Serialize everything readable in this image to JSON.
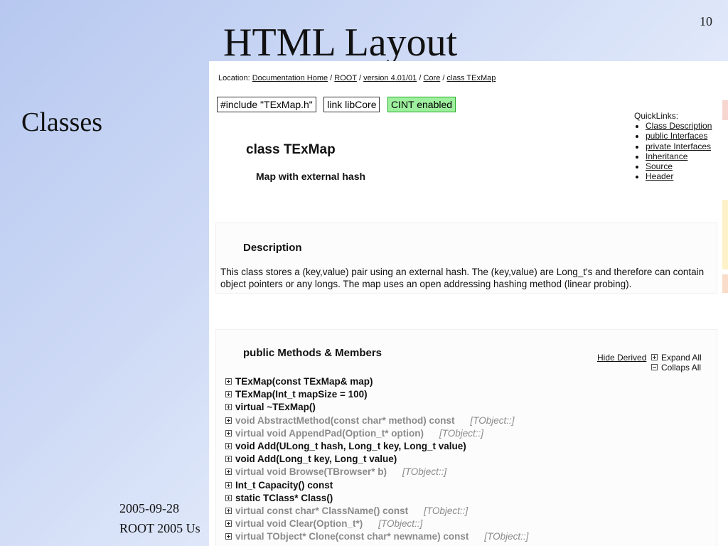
{
  "slide": {
    "number": "10",
    "title": "HTML Layout",
    "side_label": "Classes",
    "footer_date": "2005-09-28",
    "footer_conf": "ROOT 2005 Us"
  },
  "location": {
    "prefix": "Location:",
    "crumbs": [
      "Documentation Home",
      "ROOT",
      "version 4.01/01",
      "Core",
      "class TExMap"
    ],
    "separator": "/"
  },
  "badges": {
    "include": "#include \"TExMap.h\"",
    "link": "link libCore",
    "cint": "CINT enabled"
  },
  "quicklinks": {
    "title": "QuickLinks:",
    "items": [
      "Class Description",
      "public Interfaces",
      "private Interfaces",
      "Inheritance",
      "Source",
      "Header"
    ]
  },
  "class_header": {
    "title": "class TExMap",
    "subtitle": "Map with external hash"
  },
  "description": {
    "heading": "Description",
    "text": "This class stores a (key,value) pair using an external hash. The (key,value) are Long_t's and therefore can contain object pointers or any longs. The map uses an open addressing hashing method (linear probing)."
  },
  "methods": {
    "heading": "public Methods & Members",
    "hide_derived": "Hide Derived",
    "expand_all": "Expand All",
    "collapse_all": "Collaps All",
    "items": [
      {
        "sig": "TExMap(const TExMap& map)",
        "origin": "",
        "inherited": false
      },
      {
        "sig": "TExMap(Int_t mapSize = 100)",
        "origin": "",
        "inherited": false
      },
      {
        "sig": "virtual ~TExMap()",
        "origin": "",
        "inherited": false
      },
      {
        "sig": "void AbstractMethod(const char* method) const",
        "origin": "[TObject::]",
        "inherited": true
      },
      {
        "sig": "virtual void AppendPad(Option_t* option)",
        "origin": "[TObject::]",
        "inherited": true
      },
      {
        "sig": "void Add(ULong_t hash, Long_t key, Long_t value)",
        "origin": "",
        "inherited": false
      },
      {
        "sig": "void Add(Long_t key, Long_t value)",
        "origin": "",
        "inherited": false
      },
      {
        "sig": "virtual void Browse(TBrowser* b)",
        "origin": "[TObject::]",
        "inherited": true
      },
      {
        "sig": "Int_t Capacity() const",
        "origin": "",
        "inherited": false
      },
      {
        "sig": "static TClass* Class()",
        "origin": "",
        "inherited": false
      },
      {
        "sig": "virtual const char* ClassName() const",
        "origin": "[TObject::]",
        "inherited": true
      },
      {
        "sig": "virtual void Clear(Option_t*)",
        "origin": "[TObject::]",
        "inherited": true
      },
      {
        "sig": "virtual TObject* Clone(const char* newname) const",
        "origin": "[TObject::]",
        "inherited": true
      }
    ]
  },
  "colors": {
    "slide_bg": "#b7c8f0",
    "cint_badge": "#9ef09e",
    "inherited_text": "#8b8b8b"
  }
}
